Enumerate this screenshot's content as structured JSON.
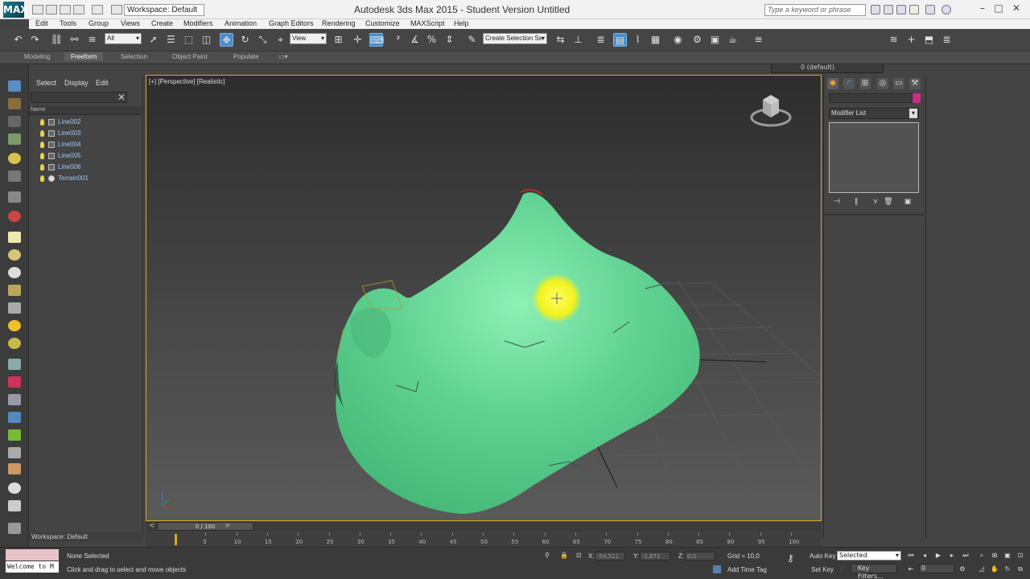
{
  "titlebar": {
    "logo": "MAX",
    "workspace": "Workspace: Default",
    "title": "Autodesk 3ds Max  2015   - Student Version      Untitled",
    "search_placeholder": "Type a keyword or phrase",
    "minimize": "–",
    "maximize": "□",
    "close": "✕"
  },
  "menu": [
    "Edit",
    "Tools",
    "Group",
    "Views",
    "Create",
    "Modifiers",
    "Animation",
    "Graph Editors",
    "Rendering",
    "Customize",
    "MAXScript",
    "Help"
  ],
  "toolbar": {
    "selection_filter": "All",
    "ref_coord": "View",
    "named_selection": "Create Selection Se",
    "layer": "0 (default)"
  },
  "ribbon": {
    "tabs": [
      "Modeling",
      "Freeform",
      "Selection",
      "Object Paint",
      "Populate"
    ],
    "active_tab": "Freeform"
  },
  "scene_explorer": {
    "menu": [
      "Select",
      "Display",
      "Edit"
    ],
    "column_header": "Name",
    "objects": [
      {
        "name": "Line002",
        "type": "shape"
      },
      {
        "name": "Line003",
        "type": "shape"
      },
      {
        "name": "Line004",
        "type": "shape"
      },
      {
        "name": "Line005",
        "type": "shape"
      },
      {
        "name": "Line006",
        "type": "shape"
      },
      {
        "name": "Terrain001",
        "type": "terrain"
      }
    ],
    "workspace_label": "Workspace: Default"
  },
  "viewport": {
    "label": "[+] [Perspective] [Realistic]",
    "terrain_color": "#5fd191",
    "highlight_color": "#ffff33",
    "border_color": "#d4aa2a"
  },
  "command_panel": {
    "modifier_list": "Modifier List",
    "color_swatch": "#c52f86"
  },
  "timeline": {
    "frame_display": "0 / 100",
    "ticks": [
      5,
      10,
      15,
      20,
      25,
      30,
      35,
      40,
      45,
      50,
      55,
      60,
      65,
      70,
      75,
      80,
      85,
      90,
      95,
      100
    ]
  },
  "status": {
    "listener_text": "Welcome to M",
    "selection_status": "None Selected",
    "prompt": "Click and drag to select and move objects",
    "x_label": "X:",
    "x_value": "-54,521",
    "y_label": "Y:",
    "y_value": "-1,871",
    "z_label": "Z:",
    "z_value": "0,0",
    "grid": "Grid = 10,0",
    "add_time_tag": "Add Time Tag",
    "auto_key": "Auto Key",
    "set_key": "Set Key",
    "selected_combo": "Selected",
    "key_filters": "Key Filters...",
    "current_frame": "0"
  }
}
